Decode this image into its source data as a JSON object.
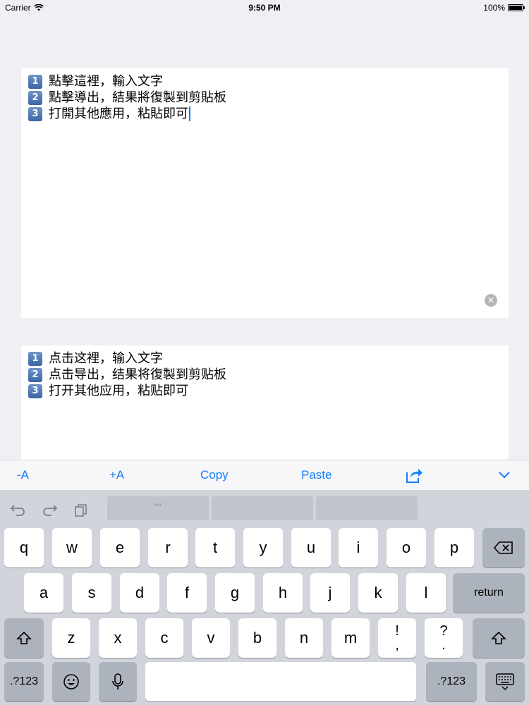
{
  "status_bar": {
    "carrier": "Carrier",
    "time": "9:50 PM",
    "battery": "100%"
  },
  "editor_traditional": {
    "lines": [
      {
        "num": "1",
        "text": "點擊這裡，輸入文字"
      },
      {
        "num": "2",
        "text": "點擊導出，結果將復製到剪貼板"
      },
      {
        "num": "3",
        "text": "打開其他應用，粘貼即可"
      }
    ],
    "clear_icon": "clear-icon"
  },
  "editor_simplified": {
    "lines": [
      {
        "num": "1",
        "text": "点击这裡，输入文字"
      },
      {
        "num": "2",
        "text": "点击导出，结果将復製到剪贴板"
      },
      {
        "num": "3",
        "text": "打开其他应用，粘贴即可"
      }
    ]
  },
  "toolbar": {
    "decrease_font": "-A",
    "increase_font": "+A",
    "copy": "Copy",
    "paste": "Paste",
    "share_icon": "share-icon",
    "dismiss_icon": "chevron-down-icon",
    "accent_color": "#157efb"
  },
  "keyboard": {
    "suggestion_1": "“”",
    "row1": [
      "q",
      "w",
      "e",
      "r",
      "t",
      "y",
      "u",
      "i",
      "o",
      "p"
    ],
    "row2": [
      "a",
      "s",
      "d",
      "f",
      "g",
      "h",
      "j",
      "k",
      "l"
    ],
    "row3": [
      "z",
      "x",
      "c",
      "v",
      "b",
      "n",
      "m"
    ],
    "punct1": [
      "!",
      ","
    ],
    "punct2": [
      "?",
      "."
    ],
    "return": "return",
    "numbers_left": ".?123",
    "numbers_right": ".?123"
  }
}
